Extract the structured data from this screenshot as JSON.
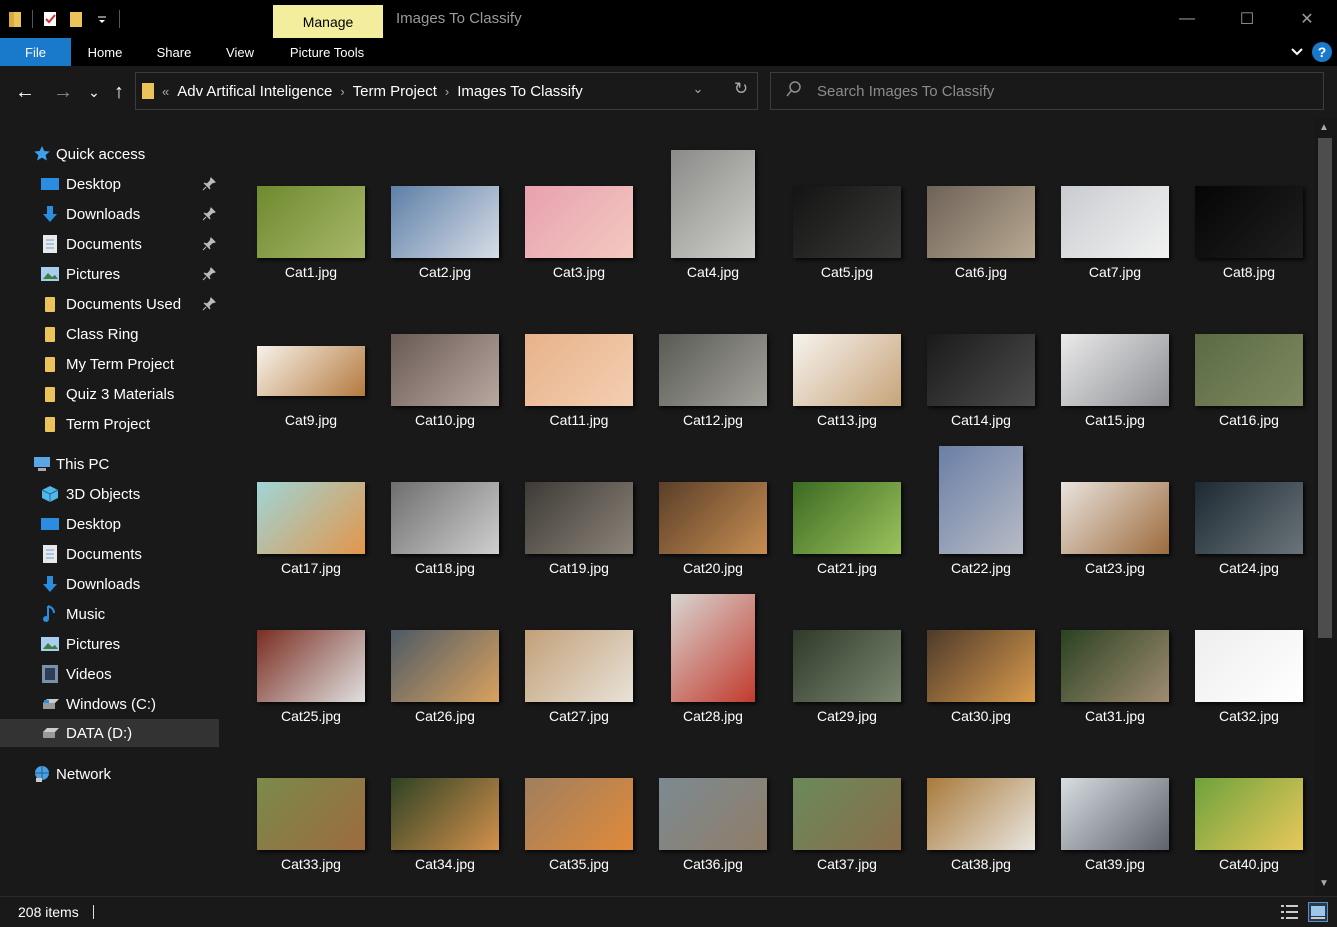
{
  "window": {
    "title": "Images To Classify",
    "manage_tab": "Manage",
    "minimize": "—",
    "maximize": "☐",
    "close": "✕"
  },
  "ribbon": {
    "tabs": [
      "File",
      "Home",
      "Share",
      "View",
      "Picture Tools"
    ],
    "help": "?"
  },
  "nav": {
    "back": "←",
    "forward": "→",
    "recent": "⌄",
    "up": "↑",
    "breadcrumb_overflow": "«",
    "breadcrumb": [
      "Adv Artifical Inteligence",
      "Term Project",
      "Images To Classify"
    ],
    "breadcrumb_sep": "›",
    "address_dropdown": "⌄",
    "refresh": "↻",
    "search_placeholder": "Search Images To Classify"
  },
  "sidebar": {
    "quick_access": {
      "label": "Quick access",
      "items": [
        {
          "label": "Desktop",
          "icon": "desktop-icon",
          "pinned": true
        },
        {
          "label": "Downloads",
          "icon": "downloads-icon",
          "pinned": true
        },
        {
          "label": "Documents",
          "icon": "documents-icon",
          "pinned": true
        },
        {
          "label": "Pictures",
          "icon": "pictures-icon",
          "pinned": true
        },
        {
          "label": "Documents Used",
          "icon": "folder-icon",
          "pinned": true
        },
        {
          "label": "Class Ring",
          "icon": "folder-icon",
          "pinned": false
        },
        {
          "label": "My Term Project",
          "icon": "folder-icon",
          "pinned": false
        },
        {
          "label": "Quiz 3 Materials",
          "icon": "folder-icon",
          "pinned": false
        },
        {
          "label": "Term Project",
          "icon": "folder-icon",
          "pinned": false
        }
      ]
    },
    "this_pc": {
      "label": "This PC",
      "items": [
        {
          "label": "3D Objects",
          "icon": "3d-objects-icon"
        },
        {
          "label": "Desktop",
          "icon": "desktop-icon"
        },
        {
          "label": "Documents",
          "icon": "documents-icon"
        },
        {
          "label": "Downloads",
          "icon": "downloads-icon"
        },
        {
          "label": "Music",
          "icon": "music-icon"
        },
        {
          "label": "Pictures",
          "icon": "pictures-icon"
        },
        {
          "label": "Videos",
          "icon": "videos-icon"
        },
        {
          "label": "Windows (C:)",
          "icon": "drive-icon"
        },
        {
          "label": "DATA (D:)",
          "icon": "drive-icon",
          "selected": true
        }
      ]
    },
    "network": {
      "label": "Network",
      "icon": "network-icon"
    }
  },
  "files": [
    {
      "name": "Cat1.jpg",
      "shape": "land",
      "colors": [
        "#6e8a2e",
        "#a8b86a"
      ]
    },
    {
      "name": "Cat2.jpg",
      "shape": "land",
      "colors": [
        "#5d7fa8",
        "#d8dde6"
      ]
    },
    {
      "name": "Cat3.jpg",
      "shape": "land",
      "colors": [
        "#e8a0b0",
        "#f4c9c0"
      ]
    },
    {
      "name": "Cat4.jpg",
      "shape": "portrait",
      "colors": [
        "#8a8a88",
        "#cfcfcb"
      ]
    },
    {
      "name": "Cat5.jpg",
      "shape": "land",
      "colors": [
        "#141414",
        "#3a3a38"
      ]
    },
    {
      "name": "Cat6.jpg",
      "shape": "land",
      "colors": [
        "#6e6258",
        "#b9a992"
      ]
    },
    {
      "name": "Cat7.jpg",
      "shape": "land",
      "colors": [
        "#c9ccd0",
        "#f2f2f2"
      ]
    },
    {
      "name": "Cat8.jpg",
      "shape": "land",
      "colors": [
        "#050505",
        "#1f1f1f"
      ]
    },
    {
      "name": "Cat9.jpg",
      "shape": "wide",
      "colors": [
        "#f7f2ea",
        "#b47a3e"
      ]
    },
    {
      "name": "Cat10.jpg",
      "shape": "land",
      "colors": [
        "#6a5a55",
        "#b9a8a0"
      ]
    },
    {
      "name": "Cat11.jpg",
      "shape": "land",
      "colors": [
        "#e8b28a",
        "#f3cfb2"
      ]
    },
    {
      "name": "Cat12.jpg",
      "shape": "land",
      "colors": [
        "#5a5a55",
        "#a3a29b"
      ]
    },
    {
      "name": "Cat13.jpg",
      "shape": "land",
      "colors": [
        "#f6f3ee",
        "#c7a47a"
      ]
    },
    {
      "name": "Cat14.jpg",
      "shape": "land",
      "colors": [
        "#1a1a1a",
        "#4c4c4c"
      ]
    },
    {
      "name": "Cat15.jpg",
      "shape": "land",
      "colors": [
        "#eaeaea",
        "#8d8f94"
      ]
    },
    {
      "name": "Cat16.jpg",
      "shape": "land",
      "colors": [
        "#5c6a45",
        "#7d8a60"
      ]
    },
    {
      "name": "Cat17.jpg",
      "shape": "land",
      "colors": [
        "#9fd5d8",
        "#e2964a"
      ]
    },
    {
      "name": "Cat18.jpg",
      "shape": "land",
      "colors": [
        "#6e6e6e",
        "#cfcfcf"
      ]
    },
    {
      "name": "Cat19.jpg",
      "shape": "land",
      "colors": [
        "#3d3a36",
        "#8c8479"
      ]
    },
    {
      "name": "Cat20.jpg",
      "shape": "land",
      "colors": [
        "#5a3f28",
        "#c78d52"
      ]
    },
    {
      "name": "Cat21.jpg",
      "shape": "land",
      "colors": [
        "#3d6a23",
        "#9bc35c"
      ]
    },
    {
      "name": "Cat22.jpg",
      "shape": "portrait",
      "colors": [
        "#6a7fa6",
        "#b8bbc5"
      ]
    },
    {
      "name": "Cat23.jpg",
      "shape": "land",
      "colors": [
        "#e9e3dc",
        "#9c6b3e"
      ]
    },
    {
      "name": "Cat24.jpg",
      "shape": "land",
      "colors": [
        "#1d2a33",
        "#6a747a"
      ]
    },
    {
      "name": "Cat25.jpg",
      "shape": "land",
      "colors": [
        "#7a2e22",
        "#e0e0e0"
      ]
    },
    {
      "name": "Cat26.jpg",
      "shape": "land",
      "colors": [
        "#4d5a66",
        "#d9a25e"
      ]
    },
    {
      "name": "Cat27.jpg",
      "shape": "land",
      "colors": [
        "#c2a078",
        "#e8e2d8"
      ]
    },
    {
      "name": "Cat28.jpg",
      "shape": "portrait",
      "colors": [
        "#d8d6d2",
        "#c23a2e"
      ]
    },
    {
      "name": "Cat29.jpg",
      "shape": "land",
      "colors": [
        "#2f3a2a",
        "#7b8670"
      ]
    },
    {
      "name": "Cat30.jpg",
      "shape": "land",
      "colors": [
        "#4e3a2a",
        "#d89b4c"
      ]
    },
    {
      "name": "Cat31.jpg",
      "shape": "land",
      "colors": [
        "#2a4220",
        "#a08c73"
      ]
    },
    {
      "name": "Cat32.jpg",
      "shape": "land",
      "colors": [
        "#eeeeee",
        "#ffffff"
      ]
    },
    {
      "name": "Cat33.jpg",
      "shape": "land",
      "colors": [
        "#7a8a4a",
        "#9d6b3e"
      ]
    },
    {
      "name": "Cat34.jpg",
      "shape": "land",
      "colors": [
        "#2e4224",
        "#d3914c"
      ]
    },
    {
      "name": "Cat35.jpg",
      "shape": "land",
      "colors": [
        "#a07f5e",
        "#e08a3a"
      ]
    },
    {
      "name": "Cat36.jpg",
      "shape": "land",
      "colors": [
        "#7c8a92",
        "#8f7d68"
      ]
    },
    {
      "name": "Cat37.jpg",
      "shape": "land",
      "colors": [
        "#6a8a5a",
        "#8a6d4a"
      ]
    },
    {
      "name": "Cat38.jpg",
      "shape": "land",
      "colors": [
        "#a87a3a",
        "#e9e6e0"
      ]
    },
    {
      "name": "Cat39.jpg",
      "shape": "land",
      "colors": [
        "#d8dde2",
        "#5e626a"
      ]
    },
    {
      "name": "Cat40.jpg",
      "shape": "land",
      "colors": [
        "#6ea23c",
        "#e8c85a"
      ]
    }
  ],
  "status": {
    "item_count": "208 items"
  }
}
